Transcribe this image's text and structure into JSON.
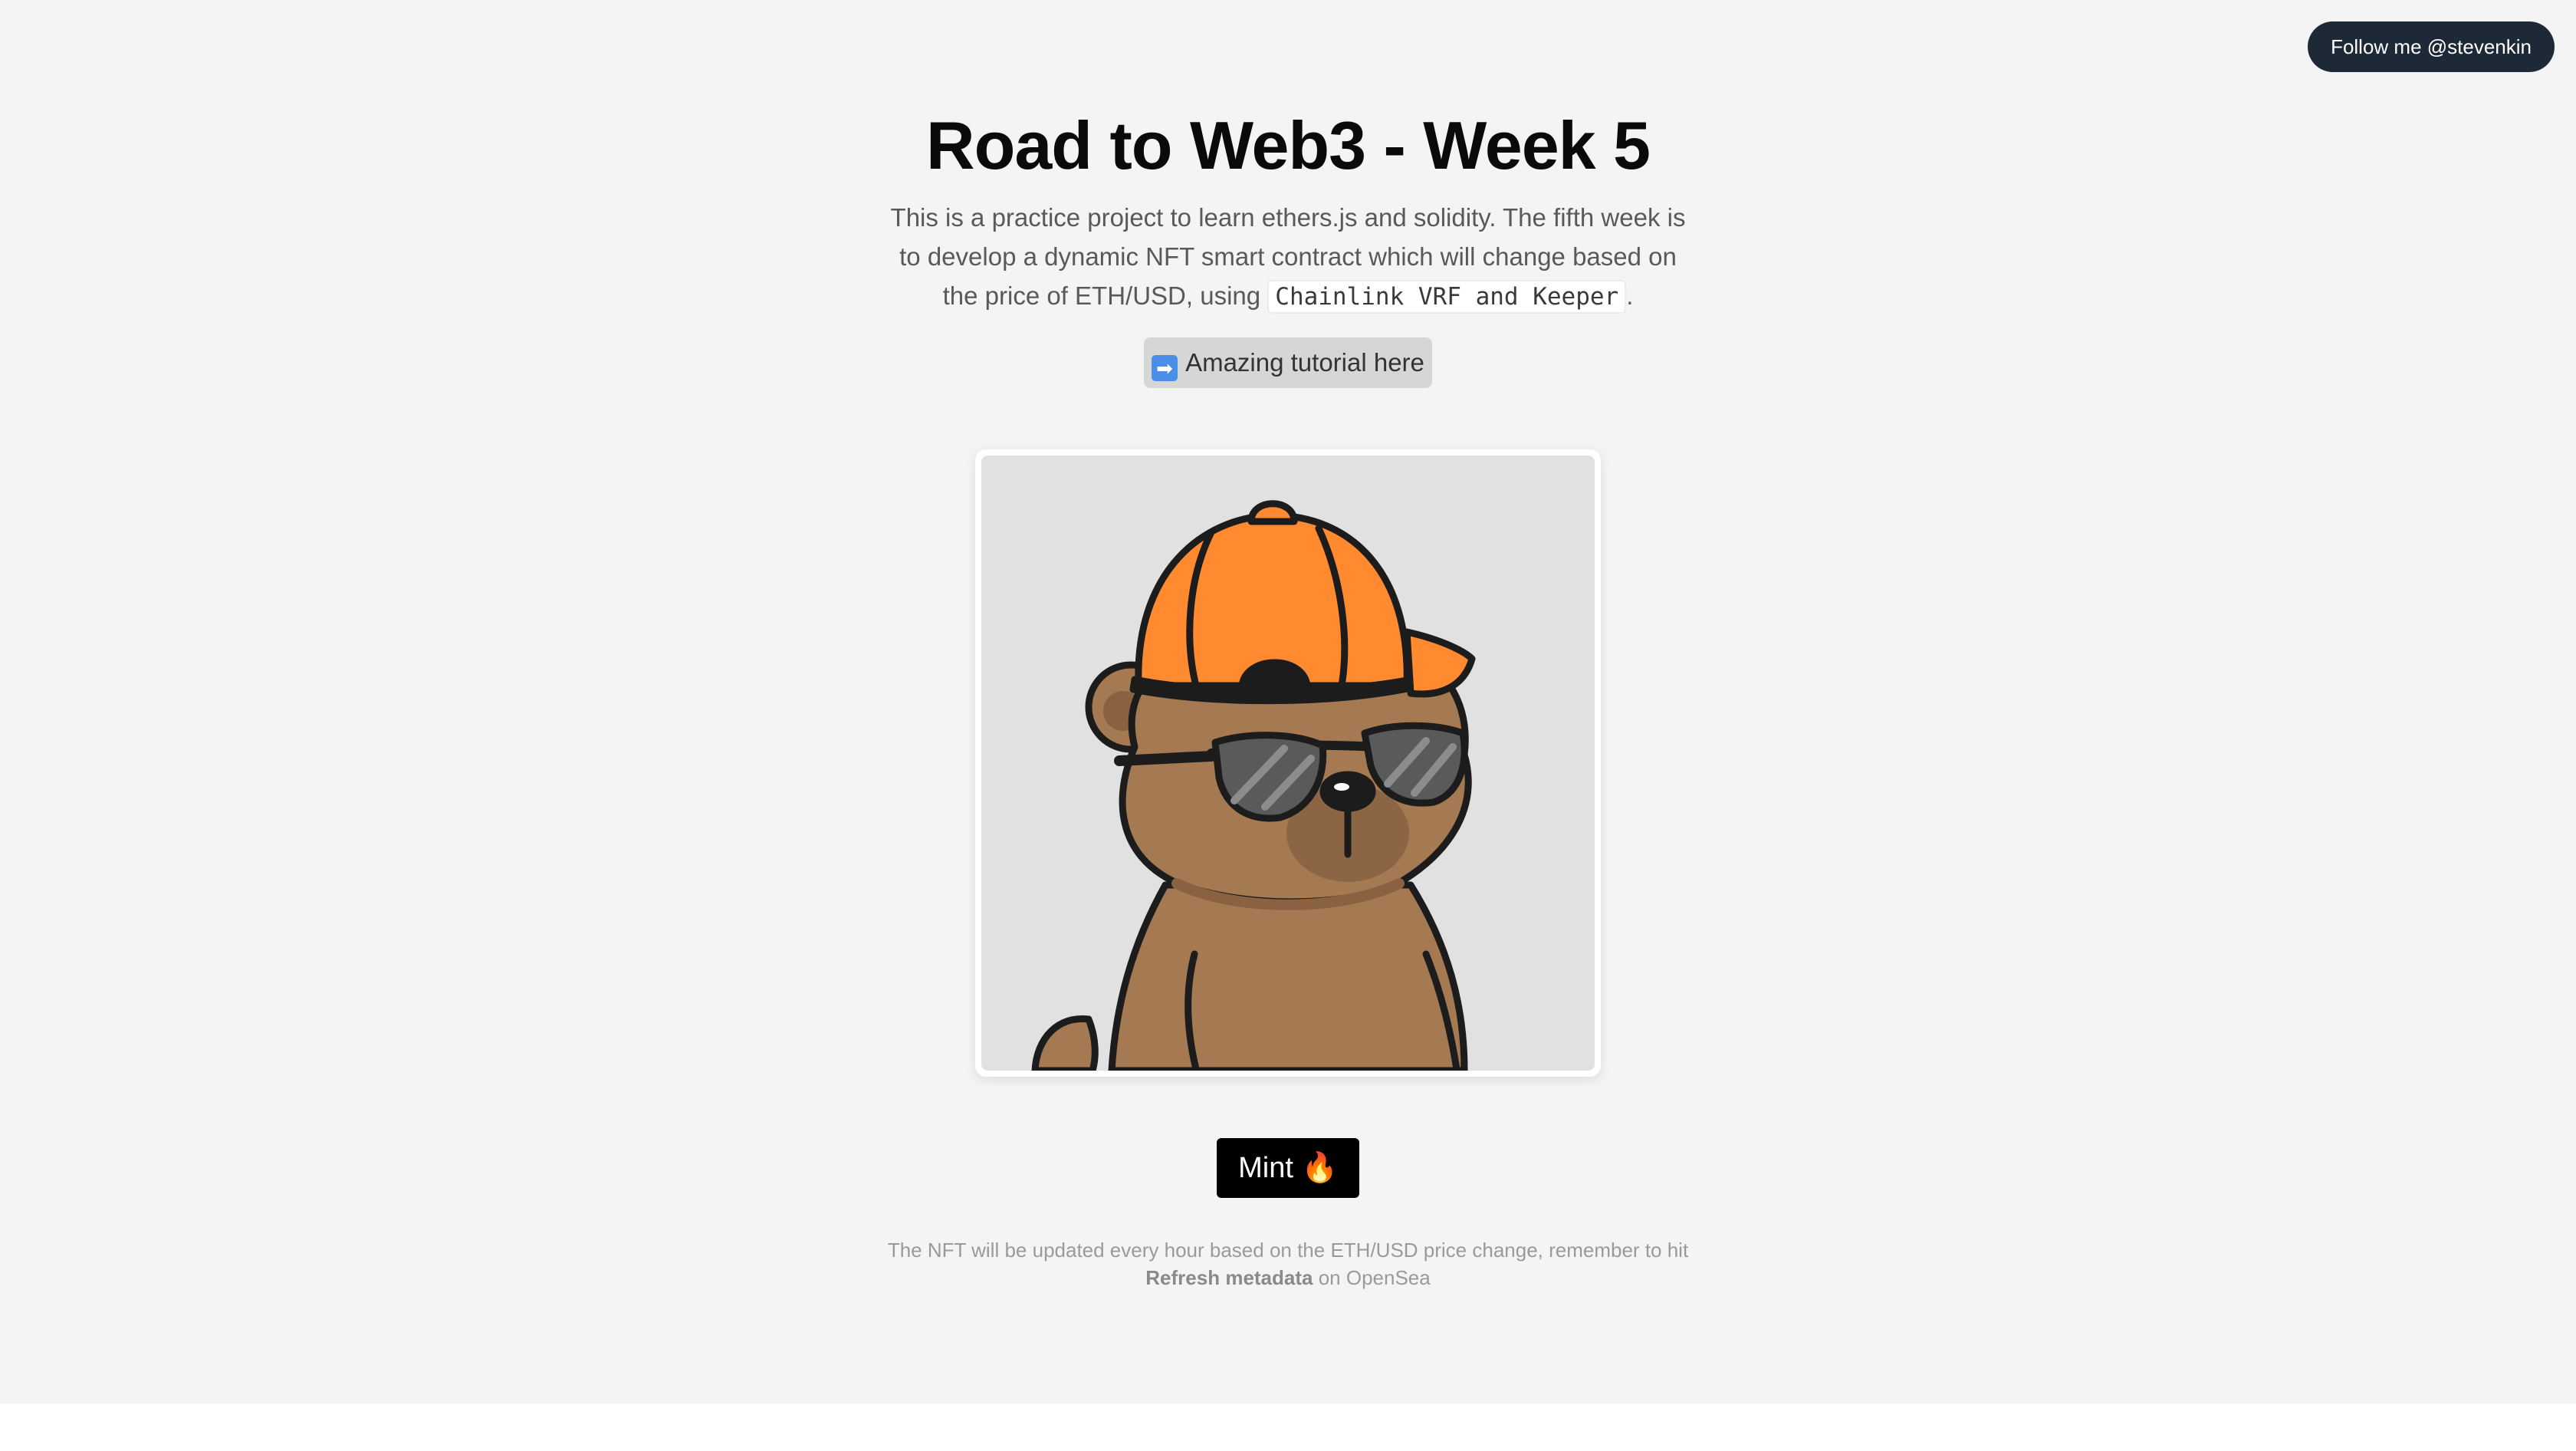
{
  "header": {
    "follow_label": "Follow me @stevenkin"
  },
  "main": {
    "title": "Road to Web3 - Week 5",
    "description_before": "This is a practice project to learn ethers.js and solidity. The fifth week is to develop a dynamic NFT smart contract which will change based on the price of ETH/USD, using ",
    "description_code": "Chainlink VRF and Keeper",
    "description_after": ".",
    "tutorial_icon": "➡",
    "tutorial_label": "Amazing tutorial here",
    "nft_image_icon": "bear-with-cap-and-sunglasses-icon",
    "mint_label": "Mint 🔥",
    "note_before": "The NFT will be updated every hour based on the ETH/USD price change, remember to hit ",
    "note_bold": "Refresh metadata",
    "note_after": " on OpenSea"
  },
  "colors": {
    "page_background": "#f4f4f4",
    "follow_button": "#1e2937",
    "mint_button": "#000000",
    "cap_orange": "#ff8a2f",
    "bear_brown": "#a57a52"
  }
}
